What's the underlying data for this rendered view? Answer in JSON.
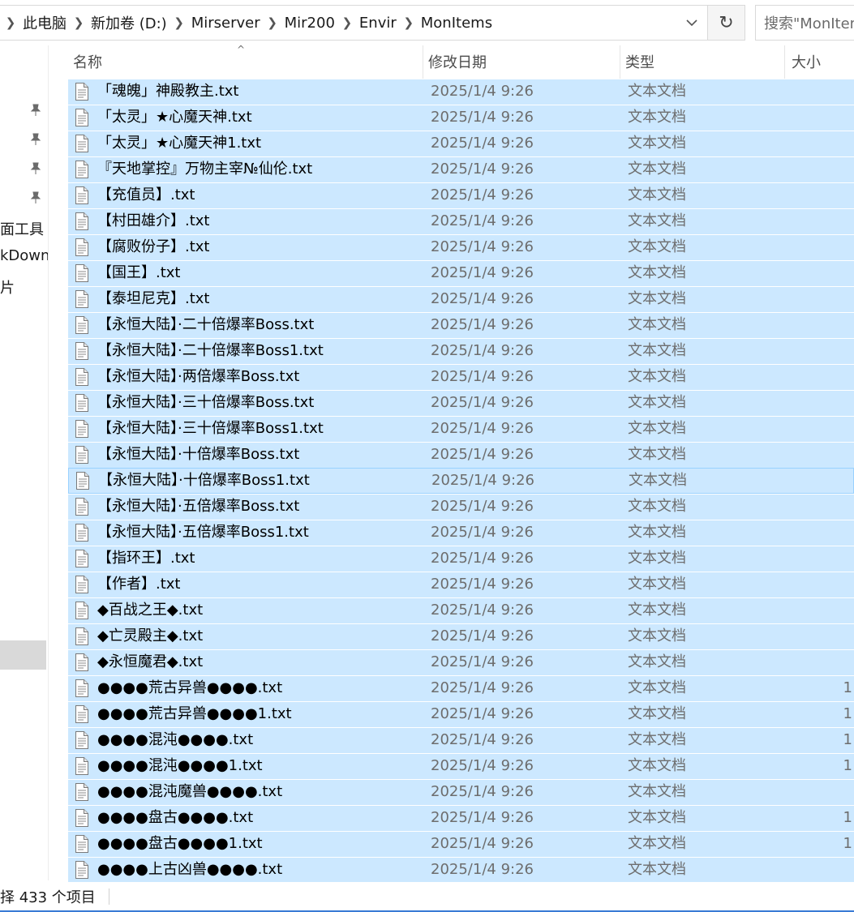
{
  "breadcrumb": [
    "此电脑",
    "新加卷 (D:)",
    "Mirserver",
    "Mir200",
    "Envir",
    "MonItems"
  ],
  "search": {
    "placeholder": "搜索\"MonItems\""
  },
  "nav": {
    "items": [
      "面工具",
      "kDown",
      "片"
    ]
  },
  "columns": {
    "name": "名称",
    "date": "修改日期",
    "type": "类型",
    "size": "大小"
  },
  "files": [
    {
      "name": "「魂魄」神殿教主.txt",
      "date": "2025/1/4 9:26",
      "type": "文本文档",
      "size": ""
    },
    {
      "name": "「太灵」★心魔天神.txt",
      "date": "2025/1/4 9:26",
      "type": "文本文档",
      "size": ""
    },
    {
      "name": "「太灵」★心魔天神1.txt",
      "date": "2025/1/4 9:26",
      "type": "文本文档",
      "size": ""
    },
    {
      "name": "『天地掌控』万物主宰№仙伦.txt",
      "date": "2025/1/4 9:26",
      "type": "文本文档",
      "size": ""
    },
    {
      "name": "【充值员】.txt",
      "date": "2025/1/4 9:26",
      "type": "文本文档",
      "size": ""
    },
    {
      "name": "【村田雄介】.txt",
      "date": "2025/1/4 9:26",
      "type": "文本文档",
      "size": ""
    },
    {
      "name": "【腐败份子】.txt",
      "date": "2025/1/4 9:26",
      "type": "文本文档",
      "size": ""
    },
    {
      "name": "【国王】.txt",
      "date": "2025/1/4 9:26",
      "type": "文本文档",
      "size": ""
    },
    {
      "name": "【泰坦尼克】.txt",
      "date": "2025/1/4 9:26",
      "type": "文本文档",
      "size": ""
    },
    {
      "name": "【永恒大陆】·二十倍爆率Boss.txt",
      "date": "2025/1/4 9:26",
      "type": "文本文档",
      "size": ""
    },
    {
      "name": "【永恒大陆】·二十倍爆率Boss1.txt",
      "date": "2025/1/4 9:26",
      "type": "文本文档",
      "size": ""
    },
    {
      "name": "【永恒大陆】·两倍爆率Boss.txt",
      "date": "2025/1/4 9:26",
      "type": "文本文档",
      "size": ""
    },
    {
      "name": "【永恒大陆】·三十倍爆率Boss.txt",
      "date": "2025/1/4 9:26",
      "type": "文本文档",
      "size": ""
    },
    {
      "name": "【永恒大陆】·三十倍爆率Boss1.txt",
      "date": "2025/1/4 9:26",
      "type": "文本文档",
      "size": ""
    },
    {
      "name": "【永恒大陆】·十倍爆率Boss.txt",
      "date": "2025/1/4 9:26",
      "type": "文本文档",
      "size": ""
    },
    {
      "name": "【永恒大陆】·十倍爆率Boss1.txt",
      "date": "2025/1/4 9:26",
      "type": "文本文档",
      "size": ""
    },
    {
      "name": "【永恒大陆】·五倍爆率Boss.txt",
      "date": "2025/1/4 9:26",
      "type": "文本文档",
      "size": ""
    },
    {
      "name": "【永恒大陆】·五倍爆率Boss1.txt",
      "date": "2025/1/4 9:26",
      "type": "文本文档",
      "size": ""
    },
    {
      "name": "【指环王】.txt",
      "date": "2025/1/4 9:26",
      "type": "文本文档",
      "size": ""
    },
    {
      "name": "【作者】.txt",
      "date": "2025/1/4 9:26",
      "type": "文本文档",
      "size": ""
    },
    {
      "name": "◆百战之王◆.txt",
      "date": "2025/1/4 9:26",
      "type": "文本文档",
      "size": ""
    },
    {
      "name": "◆亡灵殿主◆.txt",
      "date": "2025/1/4 9:26",
      "type": "文本文档",
      "size": ""
    },
    {
      "name": "◆永恒魔君◆.txt",
      "date": "2025/1/4 9:26",
      "type": "文本文档",
      "size": ""
    },
    {
      "name": "●●●●荒古异兽●●●●.txt",
      "date": "2025/1/4 9:26",
      "type": "文本文档",
      "size": "1"
    },
    {
      "name": "●●●●荒古异兽●●●●1.txt",
      "date": "2025/1/4 9:26",
      "type": "文本文档",
      "size": "1"
    },
    {
      "name": "●●●●混沌●●●●.txt",
      "date": "2025/1/4 9:26",
      "type": "文本文档",
      "size": "1"
    },
    {
      "name": "●●●●混沌●●●●1.txt",
      "date": "2025/1/4 9:26",
      "type": "文本文档",
      "size": "1"
    },
    {
      "name": "●●●●混沌魔兽●●●●.txt",
      "date": "2025/1/4 9:26",
      "type": "文本文档",
      "size": ""
    },
    {
      "name": "●●●●盘古●●●●.txt",
      "date": "2025/1/4 9:26",
      "type": "文本文档",
      "size": "1"
    },
    {
      "name": "●●●●盘古●●●●1.txt",
      "date": "2025/1/4 9:26",
      "type": "文本文档",
      "size": "1"
    },
    {
      "name": "●●●●上古凶兽●●●●.txt",
      "date": "2025/1/4 9:26",
      "type": "文本文档",
      "size": ""
    }
  ],
  "focused_index": 15,
  "status": {
    "text": "择 433 个项目"
  },
  "colors": {
    "selection": "#cce8ff",
    "focus_border": "#99d1ff",
    "status_underline": "#3a7bd5"
  },
  "icons": {
    "pin": "pin-icon",
    "file": "text-file-icon",
    "refresh": "refresh-icon",
    "dropdown": "chevron-down-icon",
    "separator": "chevron-right-icon"
  }
}
